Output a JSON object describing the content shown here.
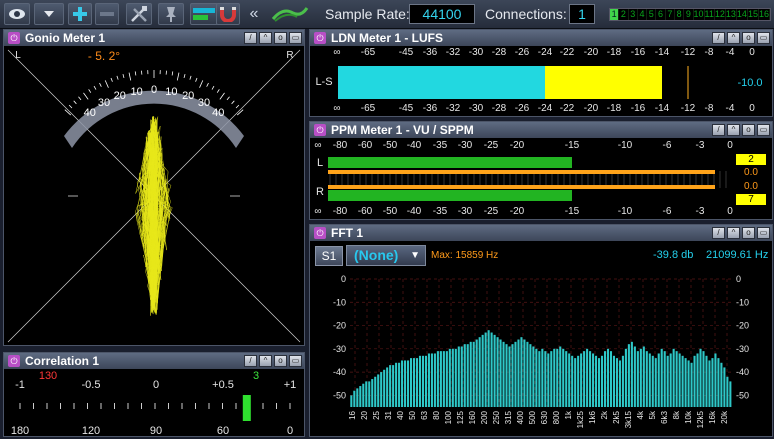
{
  "toolbar": {
    "sample_rate_label": "Sample Rate:",
    "sample_rate_value": "44100",
    "connections_label": "Connections:",
    "connections_value": "1",
    "connection_cells": [
      "1",
      "2",
      "3",
      "4",
      "5",
      "6",
      "7",
      "8",
      "9",
      "10",
      "11",
      "12",
      "13",
      "14",
      "15",
      "16"
    ],
    "active_connection": 1,
    "icons": [
      "eye-icon",
      "dropdown-icon",
      "add-icon",
      "remove-icon",
      "tools-icon",
      "pin-icon",
      "meter-icon",
      "magnet-icon",
      "collapse-icon",
      "link-icon"
    ]
  },
  "gonio": {
    "title": "Gonio Meter 1",
    "left_label": "L",
    "right_label": "R",
    "angle_readout": "- 5. 2°",
    "scale_labels": [
      "40",
      "30",
      "20",
      "10",
      "0",
      "10",
      "20",
      "30",
      "40"
    ]
  },
  "correlation": {
    "title": "Correlation 1",
    "top_labels": [
      "-1",
      "-0.5",
      "0",
      "+0.5",
      "+1"
    ],
    "bottom_labels": [
      "180",
      "120",
      "90",
      "60",
      "0"
    ],
    "left_value": "130",
    "right_value": "3",
    "correlation_value": 0.68
  },
  "ldn": {
    "title": "LDN Meter 1 - LUFS",
    "scale": [
      "∞",
      "-65",
      "-45",
      "-36",
      "-32",
      "-30",
      "-28",
      "-26",
      "-24",
      "-22",
      "-20",
      "-18",
      "-16",
      "-14",
      "-12",
      "-8",
      "-4",
      "0"
    ],
    "channel": "L-S",
    "readout": "-10.0",
    "level_cyan_db": -24,
    "level_yellow_db": -14,
    "peak_db": -12
  },
  "ppm": {
    "title": "PPM Meter 1 - VU / SPPM",
    "scale": [
      "∞",
      "-80",
      "-60",
      "-50",
      "-40",
      "-35",
      "-30",
      "-25",
      "-20",
      "-15",
      "-10",
      "-6",
      "-3",
      "0"
    ],
    "left_label": "L",
    "right_label": "R",
    "left_peak": "2",
    "left_value": "0.0",
    "right_value": "0.0",
    "right_peak": "7",
    "left_level_db": -15,
    "right_level_db": -15,
    "left_vu_db": -1.5,
    "right_vu_db": -1.5
  },
  "fft": {
    "title": "FFT 1",
    "source_button": "S1",
    "selector_value": "(None)",
    "max_label": "Max: 15859 Hz",
    "db_readout": "-39.8 db",
    "hz_readout": "21099.61 Hz",
    "y_labels": [
      "0",
      "-10",
      "-20",
      "-30",
      "-40",
      "-50"
    ],
    "x_labels": [
      "16",
      "20",
      "25",
      "31",
      "40",
      "50",
      "63",
      "80",
      "100",
      "125",
      "160",
      "200",
      "250",
      "315",
      "400",
      "500",
      "630",
      "800",
      "1k",
      "1k25",
      "1k6",
      "2k",
      "2k5",
      "3k15",
      "4k",
      "5k",
      "6k3",
      "8k",
      "10k",
      "12k5",
      "16k",
      "20k"
    ],
    "bars_db": [
      -50,
      -48,
      -47,
      -46,
      -45,
      -44,
      -44,
      -43,
      -42,
      -41,
      -40,
      -39,
      -38,
      -37,
      -37,
      -36,
      -36,
      -35,
      -35,
      -35,
      -34,
      -34,
      -34,
      -33,
      -33,
      -33,
      -32,
      -32,
      -32,
      -31,
      -31,
      -31,
      -31,
      -30,
      -30,
      -30,
      -29,
      -29,
      -28,
      -28,
      -27,
      -27,
      -26,
      -25,
      -24,
      -23,
      -22,
      -23,
      -24,
      -25,
      -26,
      -27,
      -28,
      -29,
      -28,
      -27,
      -26,
      -25,
      -26,
      -27,
      -28,
      -29,
      -30,
      -31,
      -30,
      -31,
      -32,
      -31,
      -30,
      -30,
      -29,
      -30,
      -31,
      -32,
      -33,
      -34,
      -33,
      -32,
      -31,
      -30,
      -31,
      -32,
      -33,
      -34,
      -33,
      -31,
      -30,
      -31,
      -33,
      -34,
      -35,
      -33,
      -30,
      -28,
      -27,
      -29,
      -31,
      -30,
      -29,
      -31,
      -32,
      -33,
      -34,
      -32,
      -30,
      -31,
      -33,
      -32,
      -30,
      -31,
      -32,
      -33,
      -34,
      -35,
      -36,
      -33,
      -32,
      -30,
      -31,
      -33,
      -35,
      -34,
      -32,
      -34,
      -36,
      -38,
      -42,
      -44
    ]
  }
}
